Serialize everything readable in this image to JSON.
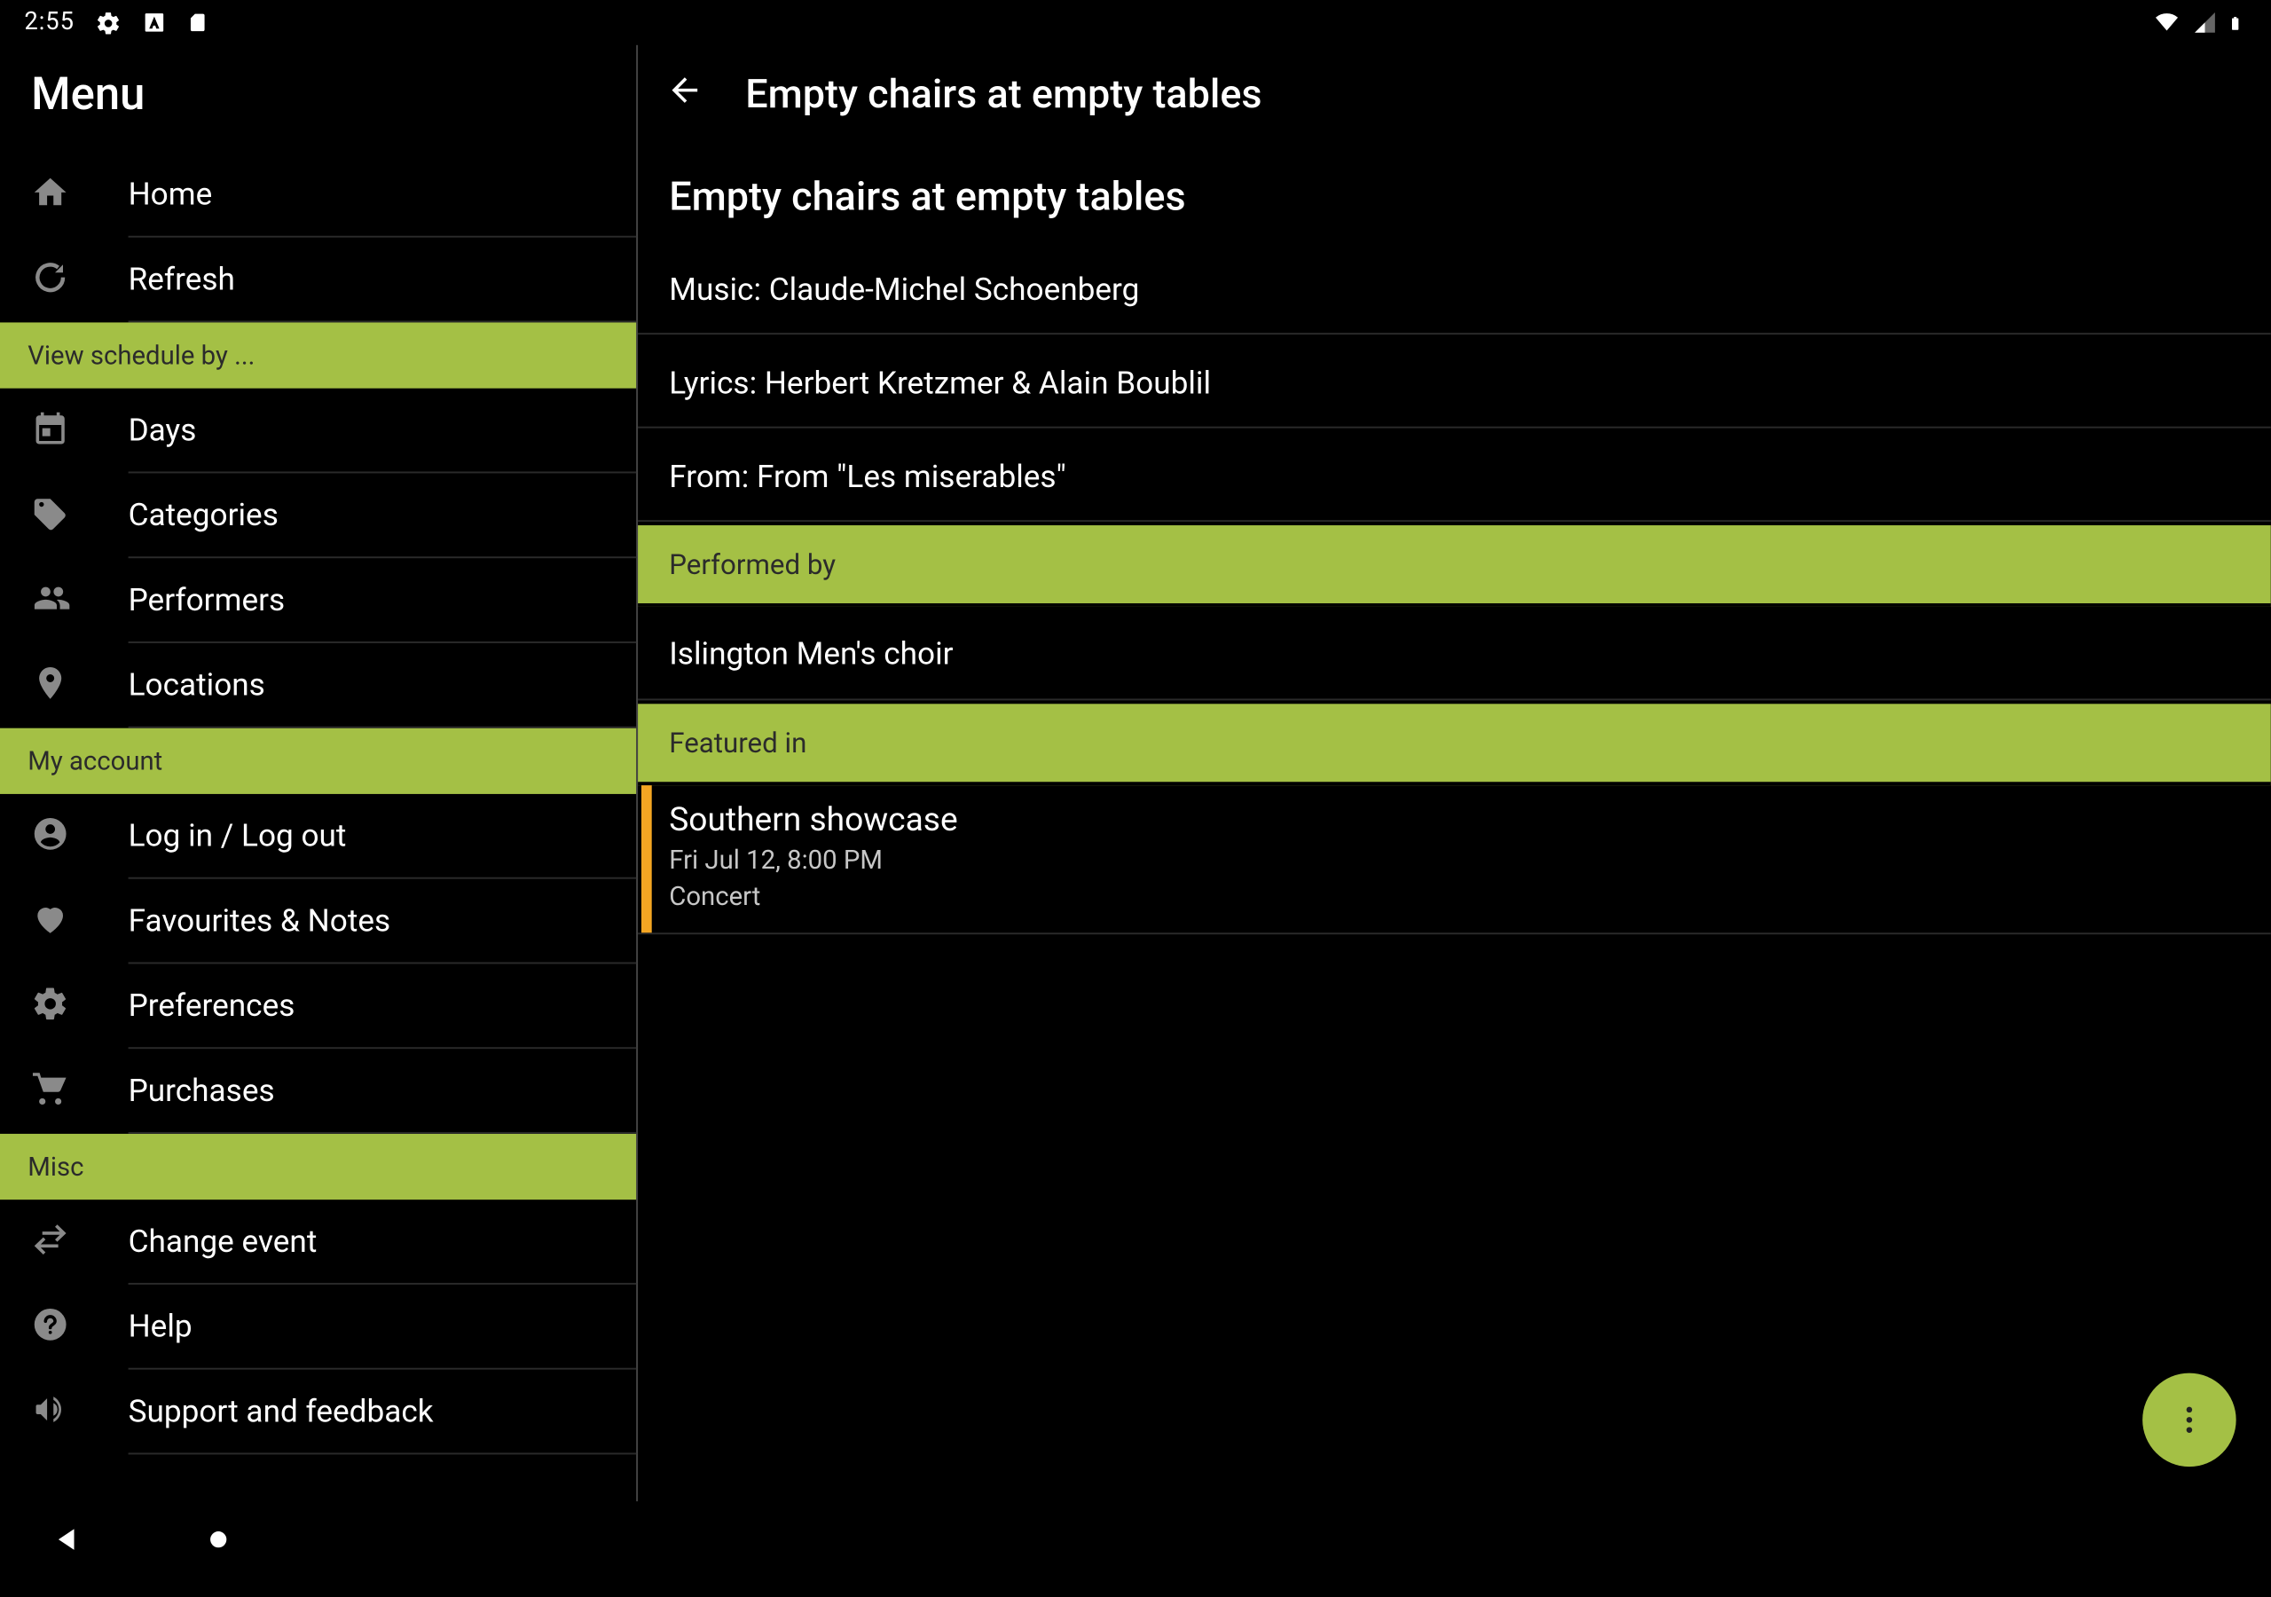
{
  "statusbar": {
    "time": "2:55"
  },
  "sidebar": {
    "title": "Menu",
    "sections": [
      {
        "header": null,
        "items": [
          {
            "id": "home",
            "label": "Home"
          },
          {
            "id": "refresh",
            "label": "Refresh"
          }
        ]
      },
      {
        "header": "View schedule by ...",
        "items": [
          {
            "id": "days",
            "label": "Days"
          },
          {
            "id": "categories",
            "label": "Categories"
          },
          {
            "id": "performers",
            "label": "Performers"
          },
          {
            "id": "locations",
            "label": "Locations"
          }
        ]
      },
      {
        "header": "My account",
        "items": [
          {
            "id": "login",
            "label": "Log in / Log out"
          },
          {
            "id": "favourites",
            "label": "Favourites & Notes"
          },
          {
            "id": "preferences",
            "label": "Preferences"
          },
          {
            "id": "purchases",
            "label": "Purchases"
          }
        ]
      },
      {
        "header": "Misc",
        "items": [
          {
            "id": "change-event",
            "label": "Change event"
          },
          {
            "id": "help",
            "label": "Help"
          },
          {
            "id": "support",
            "label": "Support and feedback"
          }
        ]
      }
    ]
  },
  "detail": {
    "header_title": "Empty chairs at empty tables",
    "title": "Empty chairs at empty tables",
    "meta": {
      "music": "Music: Claude-Michel Schoenberg",
      "lyrics": "Lyrics: Herbert Kretzmer & Alain Boublil",
      "from": "From: From \"Les miserables\""
    },
    "sections": {
      "performed_by": {
        "label": "Performed by",
        "items": [
          "Islington Men's choir"
        ]
      },
      "featured_in": {
        "label": "Featured in",
        "events": [
          {
            "title": "Southern showcase",
            "when": "Fri Jul 12, 8:00 PM",
            "type": "Concert",
            "accent": "#f5a623"
          }
        ]
      }
    }
  }
}
